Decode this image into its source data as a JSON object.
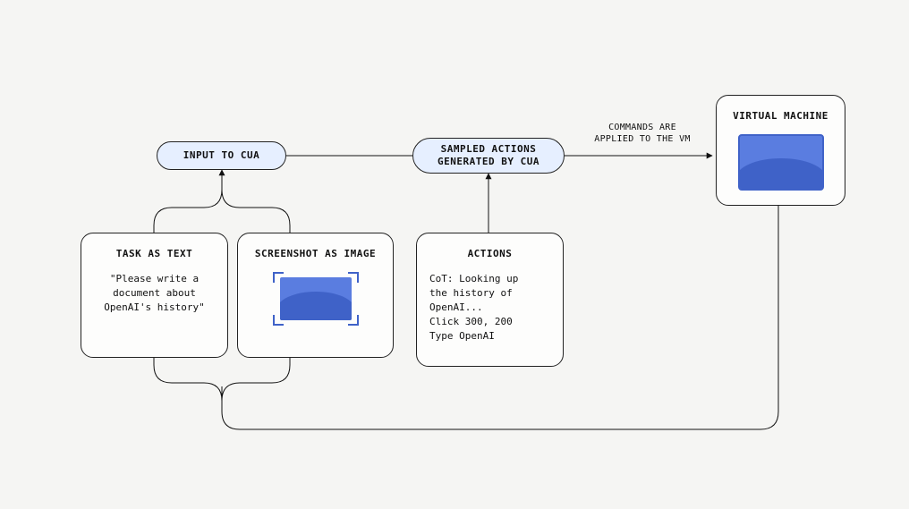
{
  "pills": {
    "input": "INPUT TO CUA",
    "sampled": "SAMPLED ACTIONS\nGENERATED BY CUA"
  },
  "cards": {
    "task": {
      "title": "TASK AS TEXT",
      "body": "\"Please write a\ndocument about\nOpenAI's history\""
    },
    "screenshot": {
      "title": "SCREENSHOT AS IMAGE"
    },
    "actions": {
      "title": "ACTIONS",
      "body": "CoT: Looking up\nthe history of\nOpenAI...\nClick 300, 200\nType OpenAI"
    },
    "vm": {
      "title": "VIRTUAL MACHINE"
    }
  },
  "edges": {
    "apply": "COMMANDS ARE\nAPPLIED TO THE VM"
  }
}
